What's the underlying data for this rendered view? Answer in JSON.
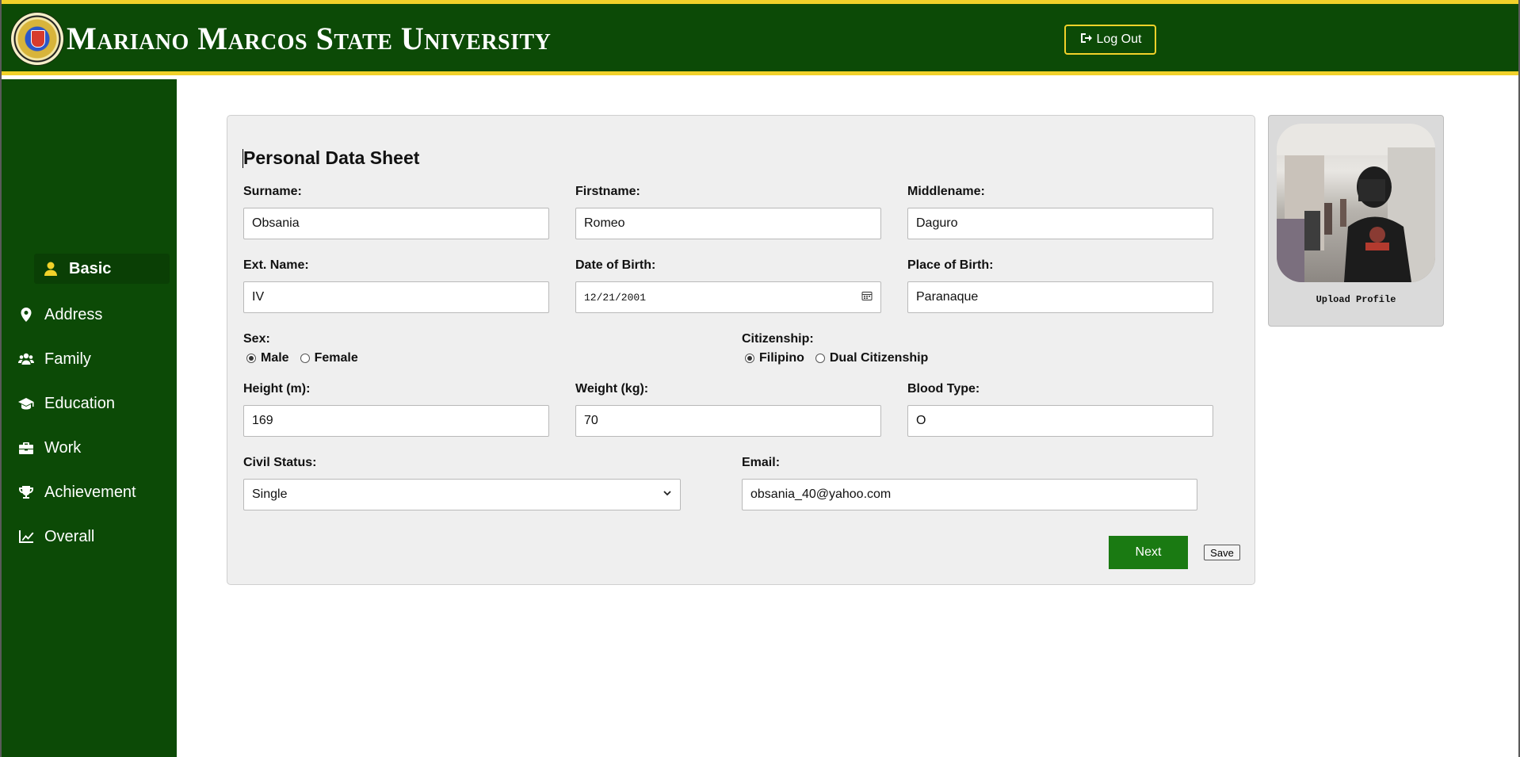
{
  "header": {
    "university_name": "Mariano Marcos State University",
    "logout_label": "Log Out",
    "seal_text": "Mariano Marcos State University 1978"
  },
  "sidebar": {
    "items": [
      {
        "label": "Basic",
        "icon": "user-icon",
        "active": true
      },
      {
        "label": "Address",
        "icon": "map-pin-icon",
        "active": false
      },
      {
        "label": "Family",
        "icon": "users-icon",
        "active": false
      },
      {
        "label": "Education",
        "icon": "graduation-cap-icon",
        "active": false
      },
      {
        "label": "Work",
        "icon": "briefcase-icon",
        "active": false
      },
      {
        "label": "Achievement",
        "icon": "trophy-icon",
        "active": false
      },
      {
        "label": "Overall",
        "icon": "line-chart-icon",
        "active": false
      }
    ]
  },
  "form": {
    "title": "Personal Data Sheet",
    "surname": {
      "label": "Surname:",
      "value": "Obsania"
    },
    "firstname": {
      "label": "Firstname:",
      "value": "Romeo"
    },
    "middlename": {
      "label": "Middlename:",
      "value": "Daguro"
    },
    "ext_name": {
      "label": "Ext. Name:",
      "value": "IV"
    },
    "dob": {
      "label": "Date of Birth:",
      "value": "12/21/2001"
    },
    "pob": {
      "label": "Place of Birth:",
      "value": "Paranaque"
    },
    "sex": {
      "label": "Sex:",
      "options": [
        "Male",
        "Female"
      ],
      "selected": "Male"
    },
    "citizenship": {
      "label": "Citizenship:",
      "options": [
        "Filipino",
        "Dual Citizenship"
      ],
      "selected": "Filipino"
    },
    "height": {
      "label": "Height (m):",
      "value": "169"
    },
    "weight": {
      "label": "Weight (kg):",
      "value": "70"
    },
    "blood_type": {
      "label": "Blood Type:",
      "value": "O"
    },
    "civil_status": {
      "label": "Civil Status:",
      "value": "Single"
    },
    "email": {
      "label": "Email:",
      "value": "obsania_40@yahoo.com"
    },
    "next_label": "Next",
    "save_label": "Save"
  },
  "profile": {
    "upload_label": "Upload Profile"
  },
  "colors": {
    "primary_green": "#0c4a06",
    "accent_yellow": "#f1d12a",
    "button_green": "#1a7a12"
  }
}
